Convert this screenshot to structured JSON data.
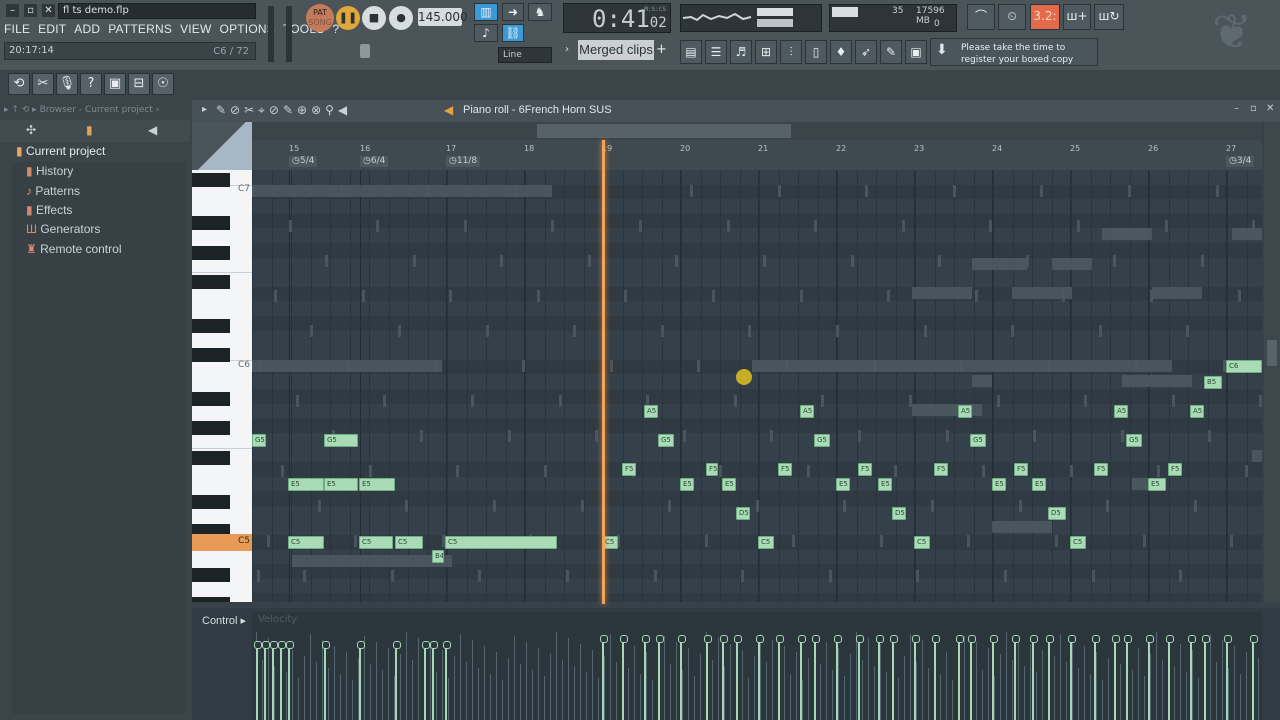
{
  "window": {
    "title": "fl ts demo.flp"
  },
  "menu": [
    "FILE",
    "EDIT",
    "ADD",
    "PATTERNS",
    "VIEW",
    "OPTIONS",
    "TOOLS",
    "?"
  ],
  "hint": {
    "time": "20:17:14",
    "right": "C6 / 72"
  },
  "transport": {
    "pat_label": "PAT",
    "song_label": "SONG",
    "tempo": "145.000",
    "time_main": "0:41",
    "time_sub": "02",
    "time_unit": "M:S:CS"
  },
  "snap": {
    "mode": "Line"
  },
  "memory": {
    "value": "17596 MB",
    "cpu": "35",
    "poly": "0"
  },
  "counter": "3.2:",
  "playlist": {
    "mode": "Merged clips"
  },
  "register": {
    "line1": "Please take the time to",
    "line2": "register your boxed copy"
  },
  "browser": {
    "header": "Browser - Current project",
    "root": "Current project",
    "items": [
      {
        "label": "History"
      },
      {
        "label": "Patterns"
      },
      {
        "label": "Effects"
      },
      {
        "label": "Generators"
      },
      {
        "label": "Remote control"
      }
    ]
  },
  "pianoroll": {
    "title": "Piano roll - 6French Horn SUS",
    "bars": [
      "15",
      "16",
      "17",
      "18",
      "19",
      "20",
      "21",
      "22",
      "23",
      "24",
      "25",
      "26",
      "27"
    ],
    "timesigs": [
      "5/4",
      "6/4",
      "11/8",
      "3/4"
    ],
    "key_labels": [
      "C7",
      "C6",
      "C5"
    ],
    "notes": [
      {
        "label": "G5"
      },
      {
        "label": "G5"
      },
      {
        "label": "E5"
      },
      {
        "label": "E5"
      },
      {
        "label": "E5"
      },
      {
        "label": "C5"
      },
      {
        "label": "C5"
      },
      {
        "label": "C5"
      },
      {
        "label": "B4"
      },
      {
        "label": "C5"
      },
      {
        "label": "C5"
      },
      {
        "label": "A5"
      },
      {
        "label": "G5"
      },
      {
        "label": "F5"
      },
      {
        "label": "E5"
      },
      {
        "label": "F5"
      },
      {
        "label": "E5"
      },
      {
        "label": "D5"
      },
      {
        "label": "C5"
      },
      {
        "label": "A5"
      },
      {
        "label": "G5"
      },
      {
        "label": "F5"
      },
      {
        "label": "F5"
      },
      {
        "label": "E5"
      },
      {
        "label": "E5"
      },
      {
        "label": "D5"
      },
      {
        "label": "C5"
      },
      {
        "label": "F5"
      },
      {
        "label": "A5"
      },
      {
        "label": "G5"
      },
      {
        "label": "F5"
      },
      {
        "label": "E5"
      },
      {
        "label": "E5"
      },
      {
        "label": "D5"
      },
      {
        "label": "F5"
      },
      {
        "label": "C5"
      },
      {
        "label": "A5"
      },
      {
        "label": "G5"
      },
      {
        "label": "F5"
      },
      {
        "label": "E5"
      },
      {
        "label": "B5"
      },
      {
        "label": "A5"
      },
      {
        "label": "C6"
      }
    ]
  },
  "control": {
    "label": "Control",
    "param": "Velocity"
  }
}
